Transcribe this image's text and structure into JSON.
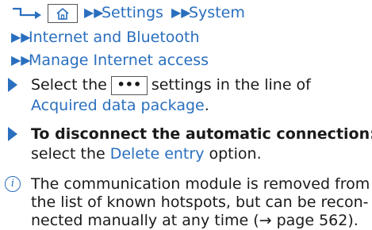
{
  "nav": {
    "crumb1": "Settings",
    "crumb2": "System",
    "line2": "Internet and Bluetooth",
    "line3": "Manage Internet access"
  },
  "step1": {
    "pre": "Select the",
    "button": "•••",
    "post": "settings in the line of",
    "link": "Acquired data package",
    "end": "."
  },
  "step2": {
    "heading": "To disconnect the automatic connection:",
    "pre": "select the",
    "link": "Delete entry",
    "post": "option."
  },
  "info": {
    "line1": "The communication module is removed from",
    "line2": "the list of known hotspots, but can be recon-",
    "line3": "nected manually at any time (→ page 562)."
  }
}
